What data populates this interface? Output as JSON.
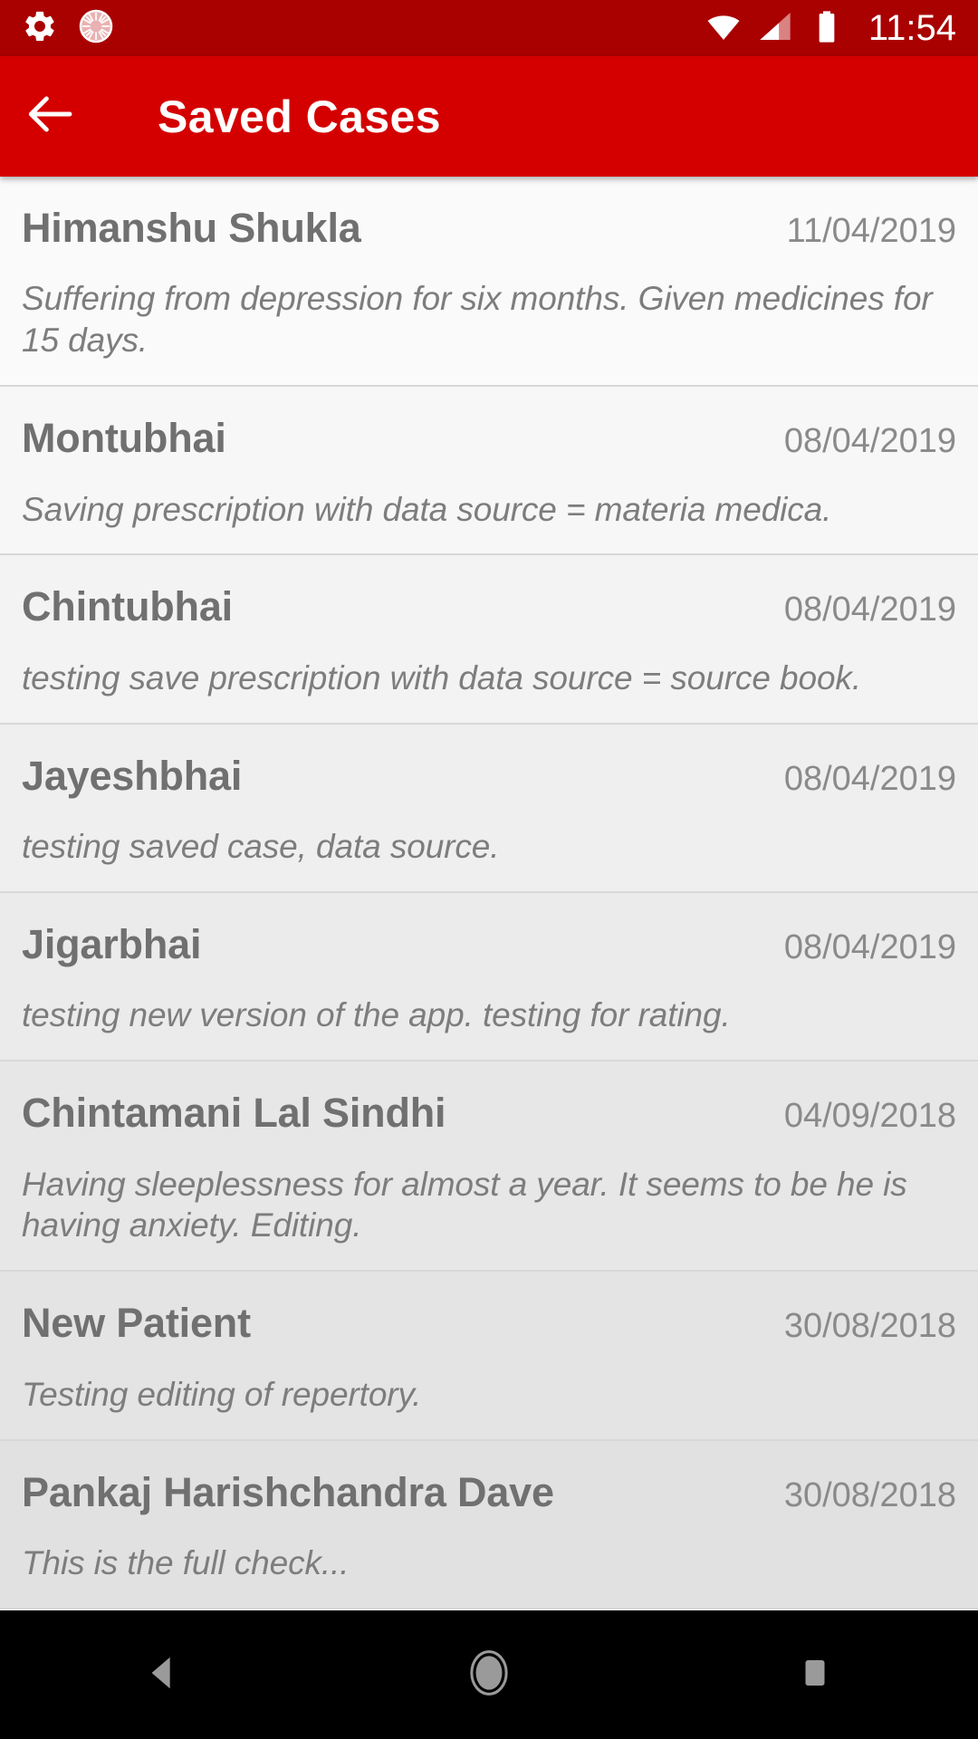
{
  "status_bar": {
    "time": "11:54",
    "background_color": "#a90000",
    "icons": [
      "gear-icon",
      "app-sunburst-icon",
      "wifi-icon",
      "cellular-signal-icon",
      "battery-icon"
    ]
  },
  "app_bar": {
    "title": "Saved Cases",
    "background_color": "#d40000",
    "back_label": "Back"
  },
  "list": {
    "items": [
      {
        "name": "Himanshu Shukla",
        "date": "11/04/2019",
        "description": "Suffering from depression for six months. Given medicines for 15 days.",
        "background": "#fafafa"
      },
      {
        "name": "Montubhai",
        "date": "08/04/2019",
        "description": "Saving prescription with data source = materia medica.",
        "background": "#f7f7f7"
      },
      {
        "name": "Chintubhai",
        "date": "08/04/2019",
        "description": "testing save prescription with data source = source book.",
        "background": "#f3f3f3"
      },
      {
        "name": "Jayeshbhai",
        "date": "08/04/2019",
        "description": "testing saved case, data source.",
        "background": "#efefef"
      },
      {
        "name": "Jigarbhai",
        "date": "08/04/2019",
        "description": "testing new version of the app. testing for rating.",
        "background": "#ebebeb"
      },
      {
        "name": "Chintamani Lal Sindhi",
        "date": "04/09/2018",
        "description": "Having sleeplessness for almost a year. It seems to be he is having anxiety. Editing.",
        "background": "#e7e7e7"
      },
      {
        "name": "New Patient",
        "date": "30/08/2018",
        "description": "Testing editing of repertory.",
        "background": "#e4e4e4"
      },
      {
        "name": "Pankaj Harishchandra Dave",
        "date": "30/08/2018",
        "description": "This is the full check...",
        "background": "#e1e1e1"
      }
    ]
  },
  "nav_bar": {
    "background_color": "#000000",
    "buttons": [
      "back-nav-button",
      "home-nav-button",
      "recents-nav-button"
    ]
  }
}
